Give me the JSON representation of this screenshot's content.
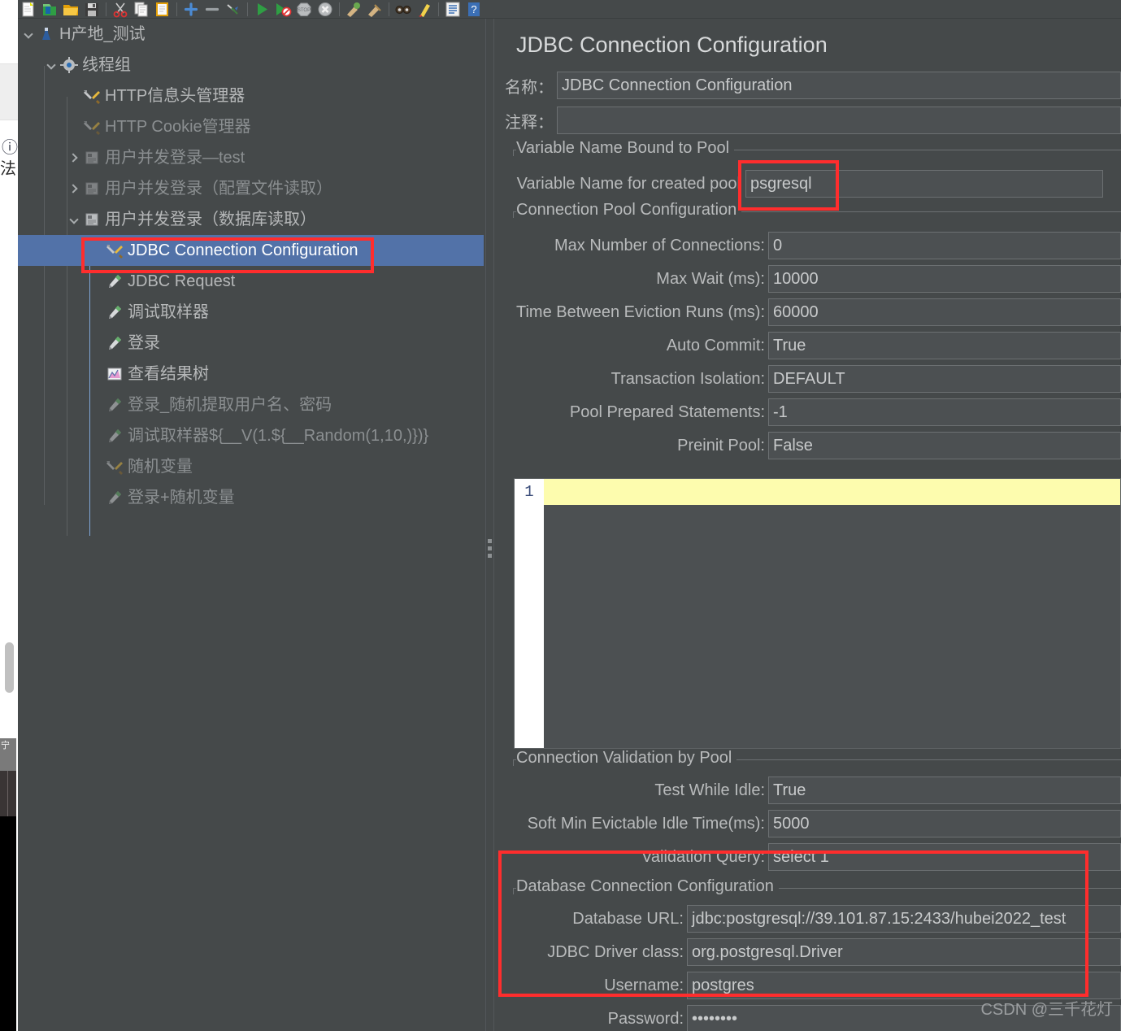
{
  "toolbar": {
    "items": [
      {
        "name": "new-icon",
        "label": "New"
      },
      {
        "name": "templates-icon",
        "label": "Templates"
      },
      {
        "name": "open-icon",
        "label": "Open"
      },
      {
        "name": "save-icon",
        "label": "Save"
      },
      {
        "name": "cut-icon",
        "label": "Cut"
      },
      {
        "name": "copy-icon",
        "label": "Copy"
      },
      {
        "name": "paste-icon",
        "label": "Paste"
      },
      {
        "name": "expand-all-icon",
        "label": "Expand All"
      },
      {
        "name": "collapse-all-icon",
        "label": "Collapse All"
      },
      {
        "name": "toggle-icon",
        "label": "Toggle"
      },
      {
        "name": "start-icon",
        "label": "Start"
      },
      {
        "name": "start-no-pauses-icon",
        "label": "Start no pauses"
      },
      {
        "name": "stop-icon",
        "label": "Stop"
      },
      {
        "name": "shutdown-icon",
        "label": "Shutdown"
      },
      {
        "name": "clear-icon",
        "label": "Clear"
      },
      {
        "name": "clear-all-icon",
        "label": "Clear All"
      },
      {
        "name": "search-icon",
        "label": "Search"
      },
      {
        "name": "reset-search-icon",
        "label": "Reset Search"
      },
      {
        "name": "function-helper-icon",
        "label": "Function Helper Dialog"
      },
      {
        "name": "help-icon",
        "label": "Help"
      }
    ]
  },
  "tree": {
    "nodes": [
      {
        "label": "H产地_测试",
        "icon": "test-plan-icon",
        "indent": 0,
        "twisty": "expanded",
        "state": "normal"
      },
      {
        "label": "线程组",
        "icon": "thread-group-icon",
        "indent": 1,
        "twisty": "expanded",
        "state": "normal"
      },
      {
        "label": "HTTP信息头管理器",
        "icon": "config-icon",
        "indent": 2,
        "twisty": "none",
        "state": "normal"
      },
      {
        "label": "HTTP Cookie管理器",
        "icon": "config-icon",
        "indent": 2,
        "twisty": "none",
        "state": "disabled"
      },
      {
        "label": "用户并发登录—test",
        "icon": "controller-icon",
        "indent": 2,
        "twisty": "collapsed",
        "state": "disabled"
      },
      {
        "label": "用户并发登录（配置文件读取）",
        "icon": "controller-icon",
        "indent": 2,
        "twisty": "collapsed",
        "state": "disabled"
      },
      {
        "label": "用户并发登录（数据库读取）",
        "icon": "controller-icon",
        "indent": 2,
        "twisty": "expanded",
        "state": "normal"
      },
      {
        "label": "JDBC Connection Configuration",
        "icon": "config-icon",
        "indent": 3,
        "twisty": "none",
        "state": "selected"
      },
      {
        "label": "JDBC Request",
        "icon": "sampler-icon",
        "indent": 3,
        "twisty": "none",
        "state": "normal"
      },
      {
        "label": "调试取样器",
        "icon": "sampler-icon",
        "indent": 3,
        "twisty": "none",
        "state": "normal"
      },
      {
        "label": "登录",
        "icon": "sampler-icon",
        "indent": 3,
        "twisty": "none",
        "state": "normal"
      },
      {
        "label": "查看结果树",
        "icon": "listener-icon",
        "indent": 3,
        "twisty": "none",
        "state": "normal"
      },
      {
        "label": "登录_随机提取用户名、密码",
        "icon": "sampler-icon",
        "indent": 3,
        "twisty": "none",
        "state": "disabled"
      },
      {
        "label": "调试取样器${__V(1.${__Random(1,10,)})}",
        "icon": "sampler-icon",
        "indent": 3,
        "twisty": "none",
        "state": "disabled"
      },
      {
        "label": "随机变量",
        "icon": "config-icon",
        "indent": 3,
        "twisty": "none",
        "state": "disabled"
      },
      {
        "label": "登录+随机变量",
        "icon": "sampler-icon",
        "indent": 3,
        "twisty": "none",
        "state": "disabled"
      }
    ]
  },
  "config": {
    "title": "JDBC Connection Configuration",
    "name_label": "名称：",
    "name_value": "JDBC Connection Configuration",
    "comment_label": "注释：",
    "comment_value": "",
    "group_variable_name_bound": "Variable Name Bound to Pool",
    "pool_var_label": "Variable Name for created pool",
    "pool_var_value": "psgresql",
    "group_connection_pool": "Connection Pool Configuration",
    "pool_fields": [
      {
        "label": "Max Number of Connections:",
        "value": "0"
      },
      {
        "label": "Max Wait (ms):",
        "value": "10000"
      },
      {
        "label": "Time Between Eviction Runs (ms):",
        "value": "60000"
      },
      {
        "label": "Auto Commit:",
        "value": "True"
      },
      {
        "label": "Transaction Isolation:",
        "value": "DEFAULT"
      },
      {
        "label": "Pool Prepared Statements:",
        "value": "-1"
      },
      {
        "label": "Preinit Pool:",
        "value": "False"
      }
    ],
    "editor": {
      "line_number": "1",
      "content": ""
    },
    "group_validation": "Connection Validation by Pool",
    "validation_fields": [
      {
        "label": "Test While Idle:",
        "value": "True"
      },
      {
        "label": "Soft Min Evictable Idle Time(ms):",
        "value": "5000"
      },
      {
        "label": "Validation Query:",
        "value": "select 1"
      }
    ],
    "group_database": "Database Connection Configuration",
    "database_fields": [
      {
        "label": "Database URL:",
        "value": "jdbc:postgresql://39.101.87.15:2433/hubei2022_test"
      },
      {
        "label": "JDBC Driver class:",
        "value": "org.postgresql.Driver"
      },
      {
        "label": "Username:",
        "value": "postgres"
      },
      {
        "label": "Password:",
        "value": "••••••••"
      }
    ]
  },
  "watermark": "CSDN @三千花灯",
  "annotations": {
    "highlight_color": "#ff2d2d",
    "boxes": [
      "tree-selected-node",
      "pool-variable-name",
      "database-connection-configuration"
    ]
  }
}
